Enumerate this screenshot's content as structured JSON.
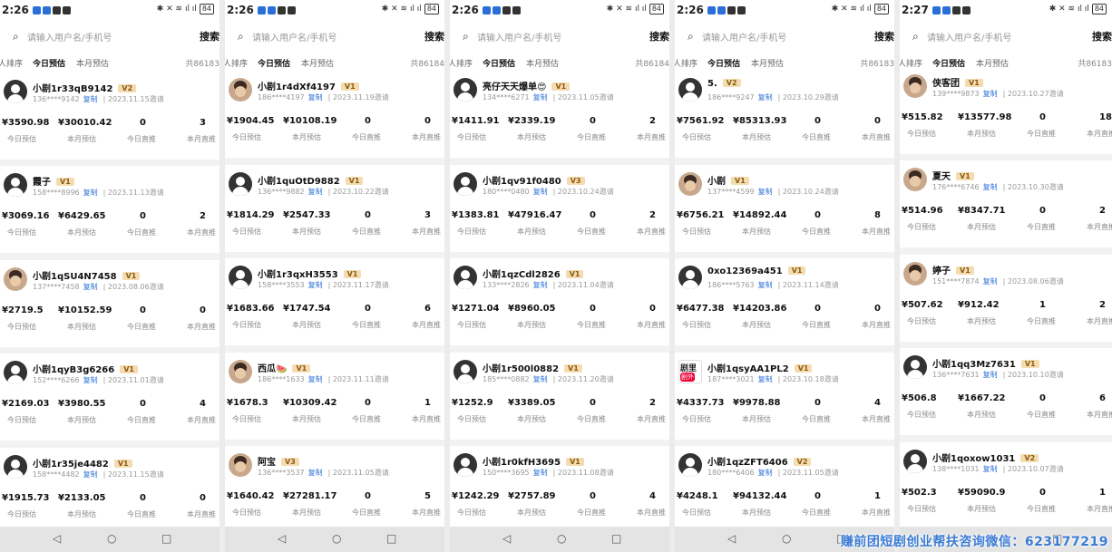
{
  "common": {
    "search_placeholder": "请输入用户名/手机号",
    "search_button": "搜索",
    "tab_sort": "人排序",
    "tab_today": "今日预估",
    "tab_month": "本月预估",
    "label_today_est": "今日预估",
    "label_month_est": "本月预估",
    "label_today_direct": "今日直推",
    "label_month_direct": "本月直推",
    "copy_label": "复制",
    "nav_back": "◁",
    "nav_home": "○",
    "nav_recent": "□"
  },
  "colors": {
    "accent_blue": "#2a6fd8",
    "badge_bg": "#f4dcb0",
    "badge_text": "#8a5a10",
    "watermark": "#3a7bd5"
  },
  "watermark": "赚前团短剧创业帮扶咨询微信：623177219",
  "panels": [
    {
      "time": "2:26",
      "total": "共86183",
      "battery": "84",
      "users": [
        {
          "name": "小剧1r33qB9142",
          "level": "V2",
          "phone": "136****9142",
          "date": "2023.11.15邀请",
          "today_est": "¥3590.98",
          "month_est": "¥30010.42",
          "today_direct": "0",
          "month_direct": "3",
          "avatar": "default"
        },
        {
          "name": "霞子",
          "level": "V1",
          "phone": "158****8996",
          "date": "2023.11.13邀请",
          "today_est": "¥3069.16",
          "month_est": "¥6429.65",
          "today_direct": "0",
          "month_direct": "2",
          "avatar": "default"
        },
        {
          "name": "小剧1qSU4N7458",
          "level": "V1",
          "phone": "137****7458",
          "date": "2023.08.06邀请",
          "today_est": "¥2719.5",
          "month_est": "¥10152.59",
          "today_direct": "0",
          "month_direct": "0",
          "avatar": "photo"
        },
        {
          "name": "小剧1qyB3g6266",
          "level": "V1",
          "phone": "152****6266",
          "date": "2023.11.01邀请",
          "today_est": "¥2169.03",
          "month_est": "¥3980.55",
          "today_direct": "0",
          "month_direct": "4",
          "avatar": "default"
        },
        {
          "name": "小剧1r35je4482",
          "level": "V1",
          "phone": "158****4482",
          "date": "2023.11.15邀请",
          "today_est": "¥1915.73",
          "month_est": "¥2133.05",
          "today_direct": "0",
          "month_direct": "0",
          "avatar": "default"
        }
      ]
    },
    {
      "time": "2:26",
      "total": "共86184",
      "battery": "84",
      "users": [
        {
          "name": "小剧1r4dXf4197",
          "level": "V1",
          "phone": "186****4197",
          "date": "2023.11.19邀请",
          "today_est": "¥1904.45",
          "month_est": "¥10108.19",
          "today_direct": "0",
          "month_direct": "0",
          "avatar": "photo"
        },
        {
          "name": "小剧1quOtD9882",
          "level": "V1",
          "phone": "136****9882",
          "date": "2023.10.22邀请",
          "today_est": "¥1814.29",
          "month_est": "¥2547.33",
          "today_direct": "0",
          "month_direct": "3",
          "avatar": "default"
        },
        {
          "name": "小剧1r3qxH3553",
          "level": "V1",
          "phone": "158****3553",
          "date": "2023.11.17邀请",
          "today_est": "¥1683.66",
          "month_est": "¥1747.54",
          "today_direct": "0",
          "month_direct": "6",
          "avatar": "default"
        },
        {
          "name": "西瓜🍉",
          "level": "V1",
          "phone": "186****1633",
          "date": "2023.11.11邀请",
          "today_est": "¥1678.3",
          "month_est": "¥10309.42",
          "today_direct": "0",
          "month_direct": "1",
          "avatar": "photo"
        },
        {
          "name": "阿宝",
          "level": "V3",
          "phone": "136****3537",
          "date": "2023.11.05邀请",
          "today_est": "¥1640.42",
          "month_est": "¥27281.17",
          "today_direct": "0",
          "month_direct": "5",
          "avatar": "photo"
        }
      ]
    },
    {
      "time": "2:26",
      "total": "共86184",
      "battery": "84",
      "users": [
        {
          "name": "亮仔天天爆单😍",
          "level": "V1",
          "phone": "134****6271",
          "date": "2023.11.05邀请",
          "today_est": "¥1411.91",
          "month_est": "¥2339.19",
          "today_direct": "0",
          "month_direct": "2",
          "avatar": "default"
        },
        {
          "name": "小剧1qv91f0480",
          "level": "V3",
          "phone": "180****0480",
          "date": "2023.10.24邀请",
          "today_est": "¥1383.81",
          "month_est": "¥47916.47",
          "today_direct": "0",
          "month_direct": "2",
          "avatar": "default"
        },
        {
          "name": "小剧1qzCdl2826",
          "level": "V1",
          "phone": "133****2826",
          "date": "2023.11.04邀请",
          "today_est": "¥1271.04",
          "month_est": "¥8960.05",
          "today_direct": "0",
          "month_direct": "0",
          "avatar": "default"
        },
        {
          "name": "小剧1r500l0882",
          "level": "V1",
          "phone": "185****0882",
          "date": "2023.11.20邀请",
          "today_est": "¥1252.9",
          "month_est": "¥3389.05",
          "today_direct": "0",
          "month_direct": "2",
          "avatar": "default"
        },
        {
          "name": "小剧1r0kfH3695",
          "level": "V1",
          "phone": "150****3695",
          "date": "2023.11.08邀请",
          "today_est": "¥1242.29",
          "month_est": "¥2757.89",
          "today_direct": "0",
          "month_direct": "4",
          "avatar": "default"
        }
      ]
    },
    {
      "time": "2:26",
      "total": "共86183",
      "battery": "84",
      "users": [
        {
          "name": "5.",
          "level": "V2",
          "phone": "186****9247",
          "date": "2023.10.29邀请",
          "today_est": "¥7561.92",
          "month_est": "¥85313.93",
          "today_direct": "0",
          "month_direct": "0",
          "avatar": "default"
        },
        {
          "name": "小剧",
          "level": "V1",
          "phone": "137****4599",
          "date": "2023.10.24邀请",
          "today_est": "¥6756.21",
          "month_est": "¥14892.44",
          "today_direct": "0",
          "month_direct": "8",
          "avatar": "photo"
        },
        {
          "name": "0xo12369a451",
          "level": "V1",
          "phone": "186****5763",
          "date": "2023.11.14邀请",
          "today_est": "¥6477.38",
          "month_est": "¥14203.86",
          "today_direct": "0",
          "month_direct": "0",
          "avatar": "default"
        },
        {
          "name": "小剧1qsyAA1PL2",
          "level": "V1",
          "phone": "187****3021",
          "date": "2023.10.18邀请",
          "today_est": "¥4337.73",
          "month_est": "¥9978.88",
          "today_direct": "0",
          "month_direct": "4",
          "avatar": "logo"
        },
        {
          "name": "小剧1qzZFT6406",
          "level": "V2",
          "phone": "180****6406",
          "date": "2023.11.05邀请",
          "today_est": "¥4248.1",
          "month_est": "¥94132.44",
          "today_direct": "0",
          "month_direct": "1",
          "avatar": "default"
        }
      ]
    },
    {
      "time": "2:27",
      "total": "共86183",
      "battery": "84",
      "users": [
        {
          "name": "侠客团",
          "level": "V1",
          "phone": "139****9873",
          "date": "2023.10.27邀请",
          "today_est": "¥515.82",
          "month_est": "¥13577.98",
          "today_direct": "0",
          "month_direct": "18",
          "avatar": "photo"
        },
        {
          "name": "夏天",
          "level": "V1",
          "phone": "176****6746",
          "date": "2023.10.30邀请",
          "today_est": "¥514.96",
          "month_est": "¥8347.71",
          "today_direct": "0",
          "month_direct": "2",
          "avatar": "photo"
        },
        {
          "name": "婷子",
          "level": "V1",
          "phone": "151****7874",
          "date": "2023.08.06邀请",
          "today_est": "¥507.62",
          "month_est": "¥912.42",
          "today_direct": "1",
          "month_direct": "2",
          "avatar": "photo"
        },
        {
          "name": "小剧1qq3Mz7631",
          "level": "V1",
          "phone": "136****7631",
          "date": "2023.10.10邀请",
          "today_est": "¥506.8",
          "month_est": "¥1667.22",
          "today_direct": "0",
          "month_direct": "6",
          "avatar": "default"
        },
        {
          "name": "小剧1qoxow1031",
          "level": "V2",
          "phone": "138****1031",
          "date": "2023.10.07邀请",
          "today_est": "¥502.3",
          "month_est": "¥59090.9",
          "today_direct": "0",
          "month_direct": "1",
          "avatar": "default"
        }
      ]
    }
  ]
}
